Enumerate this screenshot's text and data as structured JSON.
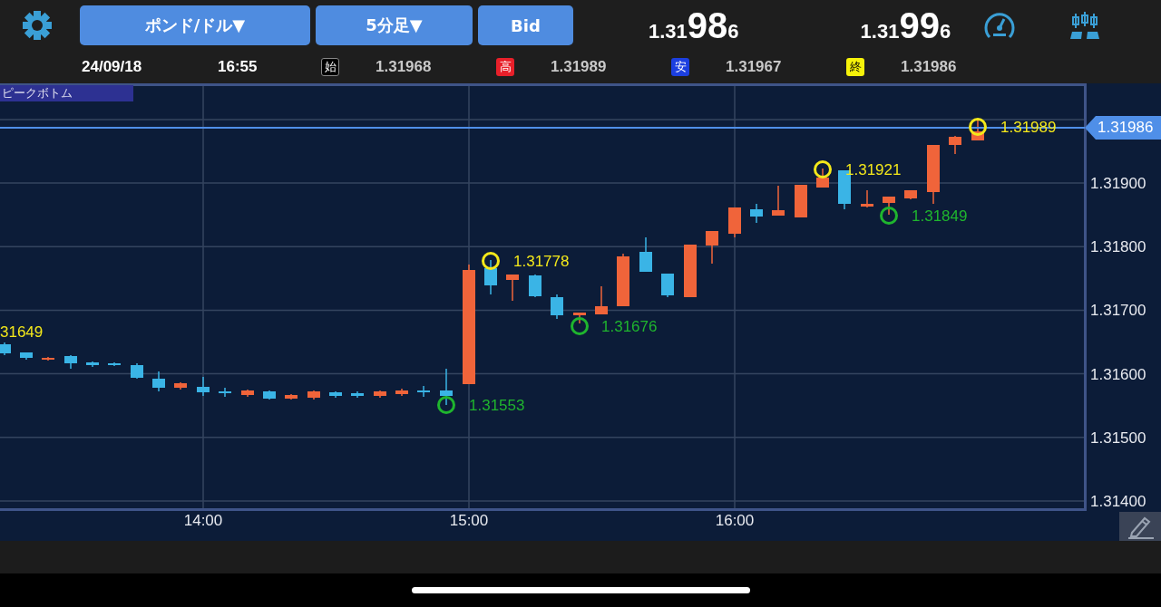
{
  "header": {
    "buttons": [
      {
        "label": "ポンド/ドル▼"
      },
      {
        "label": "5分足▼"
      },
      {
        "label": "Bid"
      }
    ],
    "quotes": [
      {
        "prefix": "1.31",
        "big": "98",
        "suffix": "6"
      },
      {
        "prefix": "1.31",
        "big": "99",
        "suffix": "6"
      }
    ],
    "date": "24/09/18",
    "time": "16:55",
    "ohlc": [
      {
        "kind": "open",
        "badge": "始",
        "value": "1.31968"
      },
      {
        "kind": "high",
        "badge": "高",
        "value": "1.31989"
      },
      {
        "kind": "low",
        "badge": "安",
        "value": "1.31967"
      },
      {
        "kind": "close",
        "badge": "終",
        "value": "1.31986"
      }
    ]
  },
  "chart": {
    "legend": "ピークボトム",
    "y_axis_labels": [
      "1.31900",
      "1.31800",
      "1.31700",
      "1.31600",
      "1.31500",
      "1.31400"
    ],
    "x_axis_labels": [
      "14:00",
      "15:00",
      "16:00"
    ],
    "current_price": "1.31986",
    "markers": [
      {
        "kind": "peak",
        "label": "31649"
      },
      {
        "kind": "bottom",
        "label": "1.31553"
      },
      {
        "kind": "peak",
        "label": "1.31778"
      },
      {
        "kind": "bottom",
        "label": "1.31676"
      },
      {
        "kind": "peak",
        "label": "1.31921"
      },
      {
        "kind": "bottom",
        "label": "1.31849"
      },
      {
        "kind": "peak",
        "label": "1.31989"
      }
    ]
  }
}
